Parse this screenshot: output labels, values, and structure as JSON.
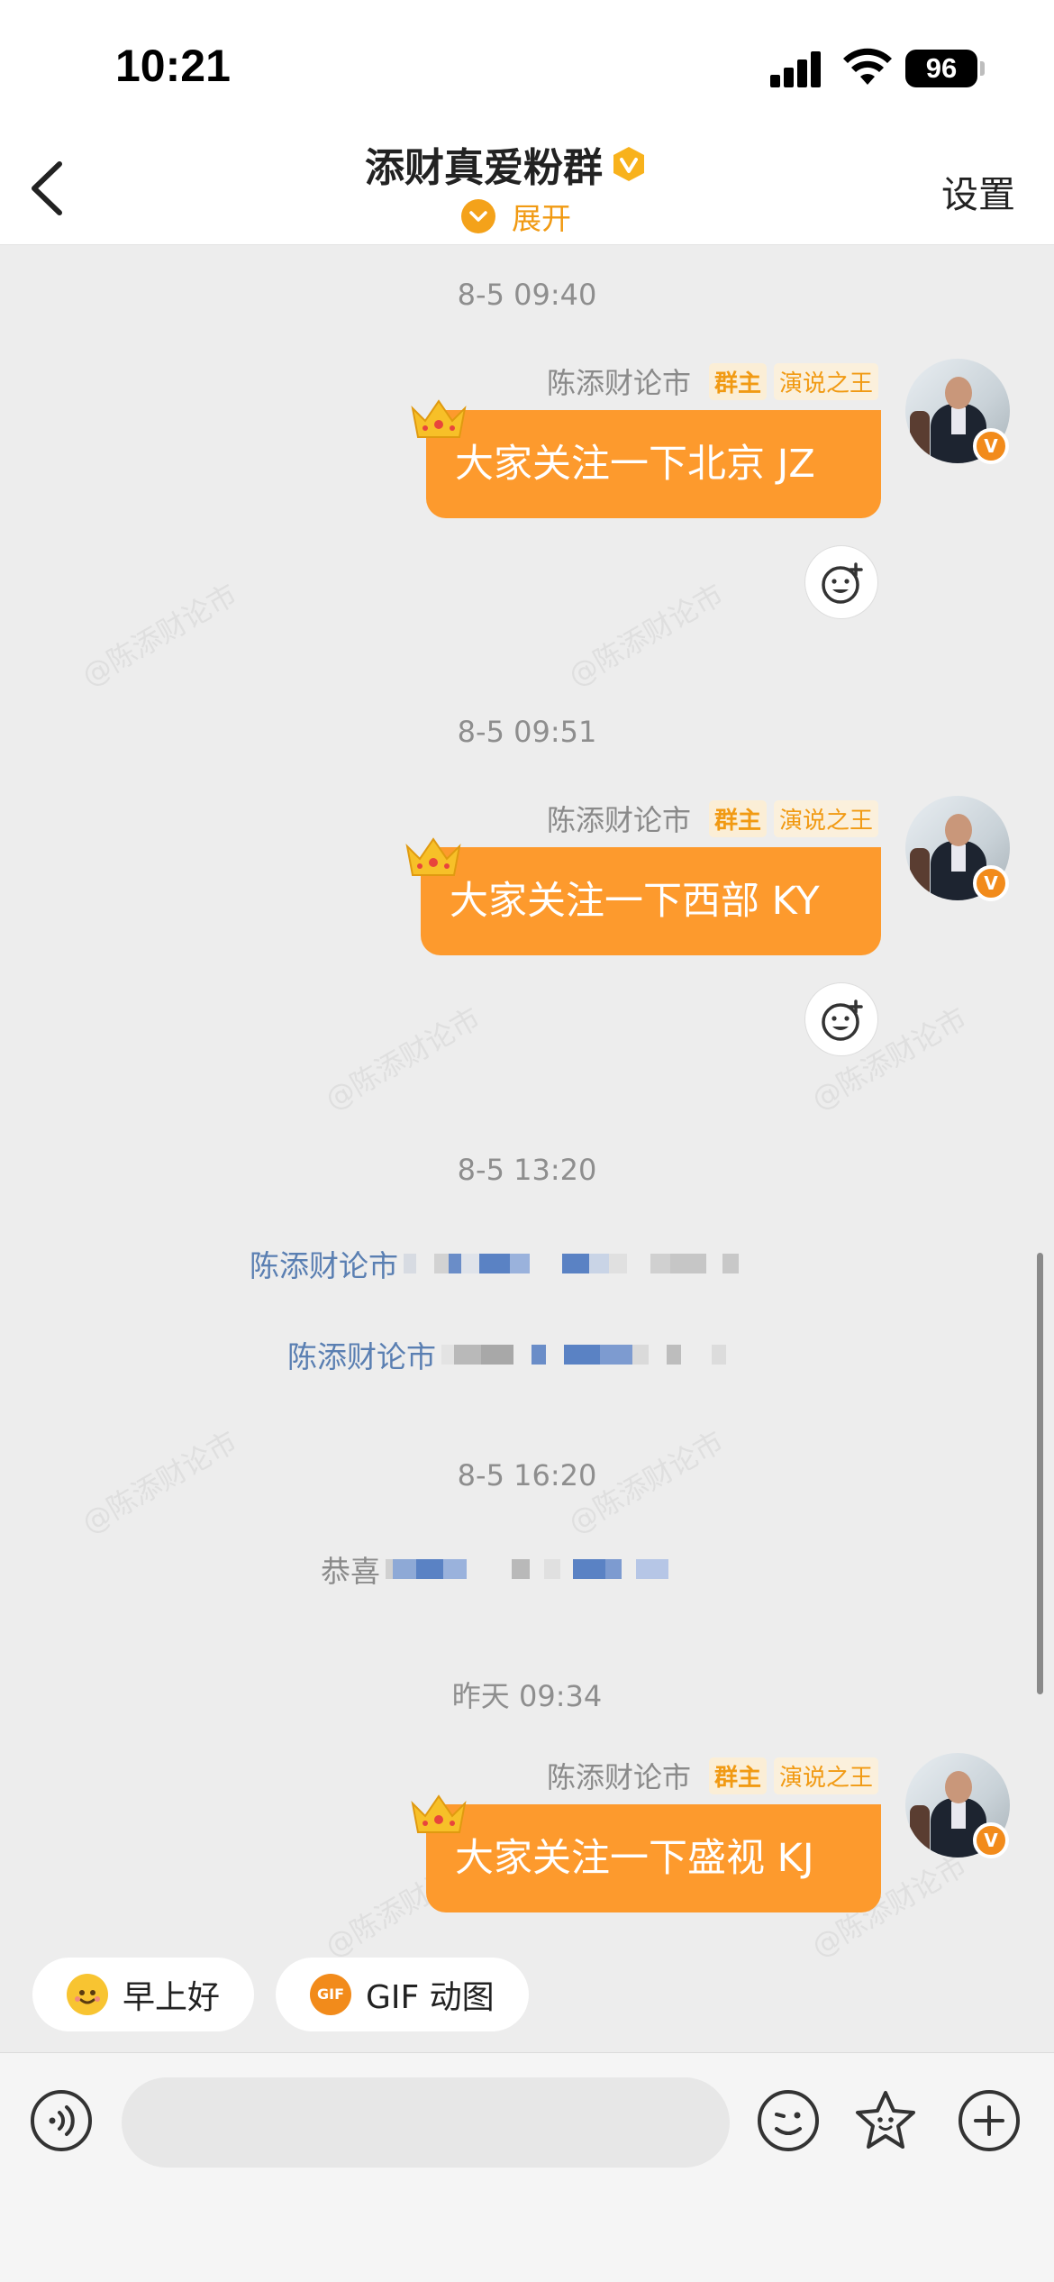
{
  "status_bar": {
    "time": "10:21",
    "battery": "96"
  },
  "header": {
    "title": "添财真爱粉群",
    "expand_label": "展开",
    "settings_label": "设置"
  },
  "watermark_text": "@陈添财论市",
  "messages": [
    {
      "timestamp": "8-5 09:40",
      "sender": "陈添财论市",
      "tags": [
        "群主",
        "演说之王"
      ],
      "text": "大家关注一下北京 JZ"
    },
    {
      "timestamp": "8-5 09:51",
      "sender": "陈添财论市",
      "tags": [
        "群主",
        "演说之王"
      ],
      "text": "大家关注一下西部 KY"
    },
    {
      "timestamp": "8-5 13:20",
      "system_lines": [
        "陈添财论市",
        "陈添财论市"
      ]
    },
    {
      "timestamp": "8-5 16:20",
      "system_lines": [
        "恭喜"
      ]
    },
    {
      "timestamp": "昨天 09:34",
      "sender": "陈添财论市",
      "tags": [
        "群主",
        "演说之王"
      ],
      "text": "大家关注一下盛视 KJ"
    }
  ],
  "quick_replies": [
    {
      "label": "早上好",
      "icon": "sun-face-icon"
    },
    {
      "label": "GIF 动图",
      "icon": "gif-icon",
      "icon_text": "GIF"
    }
  ],
  "colors": {
    "accent": "#fd9a2d",
    "link": "#5a7fb2",
    "tag_text": "#f19a13"
  }
}
